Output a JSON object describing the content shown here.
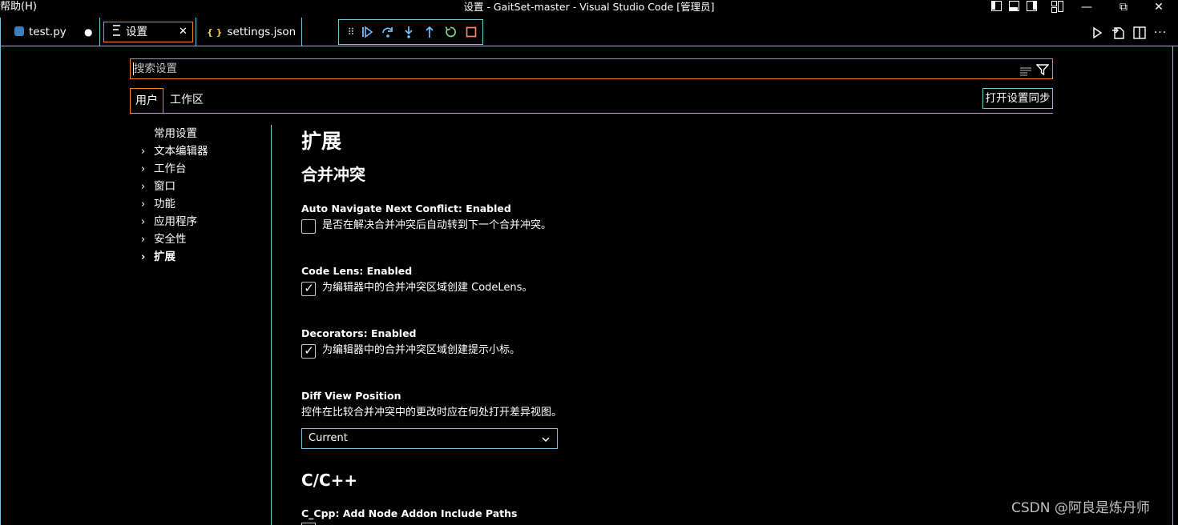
{
  "titlebar": {
    "menu_help": "帮助(H)",
    "window_title": "设置 - GaitSet-master - Visual Studio Code [管理员]",
    "controls": {
      "minimize": "—",
      "restore": "⧉",
      "close": "✕"
    }
  },
  "tabs": [
    {
      "label": "test.py",
      "icon": "python-icon",
      "dirty_dot": "●"
    },
    {
      "label": "设置",
      "icon": "settings-file-icon",
      "close": "✕"
    },
    {
      "label": "settings.json",
      "icon": "json-braces-icon",
      "icon_text": "{ }"
    }
  ],
  "debug_toolbar": {
    "grip": "⠿",
    "items": [
      "continue-icon",
      "step-over-icon",
      "step-into-icon",
      "step-out-icon",
      "restart-icon",
      "stop-icon"
    ]
  },
  "search": {
    "placeholder": "搜索设置"
  },
  "scope": {
    "user": "用户",
    "workspace": "工作区",
    "sync_button": "打开设置同步"
  },
  "toc": [
    {
      "label": "常用设置",
      "chevron": ""
    },
    {
      "label": "文本编辑器",
      "chevron": "›"
    },
    {
      "label": "工作台",
      "chevron": "›"
    },
    {
      "label": "窗口",
      "chevron": "›"
    },
    {
      "label": "功能",
      "chevron": "›"
    },
    {
      "label": "应用程序",
      "chevron": "›"
    },
    {
      "label": "安全性",
      "chevron": "›"
    },
    {
      "label": "扩展",
      "chevron": "›"
    }
  ],
  "content": {
    "heading": "扩展",
    "section_merge": "合并冲突",
    "settings": [
      {
        "title": "Auto Navigate Next Conflict: Enabled",
        "desc": "是否在解决合并冲突后自动转到下一个合并冲突。",
        "checked": false
      },
      {
        "title": "Code Lens: Enabled",
        "desc": "为编辑器中的合并冲突区域创建 CodeLens。",
        "checked": true
      },
      {
        "title": "Decorators: Enabled",
        "desc": "为编辑器中的合并冲突区域创建提示小标。",
        "checked": true
      }
    ],
    "diff_view": {
      "title": "Diff View Position",
      "desc": "控件在比较合并冲突中的更改时应在何处打开差异视图。",
      "value": "Current"
    },
    "section_cpp": "C/C++",
    "cpp_setting_title": "C_Cpp: Add Node Addon Include Paths"
  },
  "watermark": "CSDN @阿良是炼丹师",
  "colors": {
    "focus_border": "#f38518",
    "contrast_border": "#6fc3df",
    "background": "#000000"
  }
}
